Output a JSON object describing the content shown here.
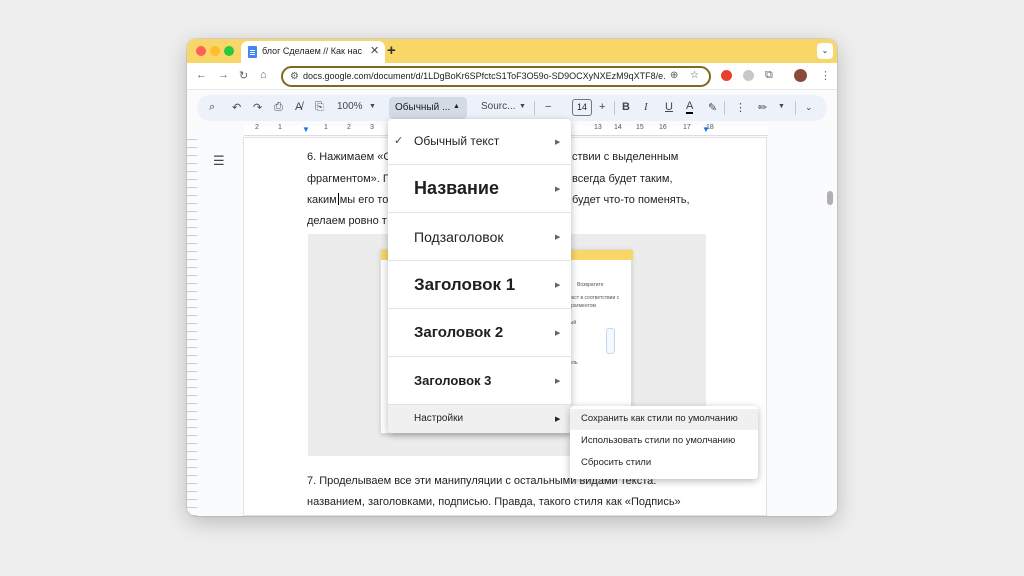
{
  "tab": {
    "title": "блог Сделаем // Как настроить"
  },
  "address": {
    "url": "docs.google.com/document/d/1LDgBoKr6SPfctcS1ToF3O59o-SD9OCXyNXEzM9qXTF8/e..."
  },
  "toolbar": {
    "zoom": "100%",
    "style_value": "Обычный ...",
    "font_value": "Sourc...",
    "font_size": "14"
  },
  "ruler": {
    "numbers": [
      "2",
      "1",
      "1",
      "2",
      "3",
      "4",
      "5",
      "6",
      "7",
      "8",
      "9",
      "10",
      "11",
      "12",
      "13",
      "14",
      "15",
      "16",
      "17",
      "18"
    ]
  },
  "document": {
    "step6_lines": [
      "6. Нажимаем «С",
      "фрагментом». Г",
      "каким",
      "мы его то",
      "делаем ровно т"
    ],
    "step6_right": [
      "ствии с выделенным",
      "всегда будет таким,",
      "будет что-то поменять,"
    ],
    "step7_lines": [
      "7. Проделываем все эти манипуляции с остальными видами текста:",
      "названием, заголовками, подписью. Правда, такого стиля как «Подпись»"
    ]
  },
  "mini_screenshot": {
    "text1": "Обычный текст",
    "text2": "Возвратите",
    "text3": "текст в соответствии с",
    "text4": "фрагментом",
    "text5": "ный",
    "text6": "пуль"
  },
  "style_menu": {
    "items": [
      {
        "label": "Обычный текст",
        "checked": true
      },
      {
        "label": "Название"
      },
      {
        "label": "Подзаголовок"
      },
      {
        "label": "Заголовок 1"
      },
      {
        "label": "Заголовок 2"
      },
      {
        "label": "Заголовок 3"
      },
      {
        "label": "Настройки"
      }
    ]
  },
  "settings_submenu": {
    "items": [
      {
        "label": "Сохранить как стили по умолчанию"
      },
      {
        "label": "Использовать стили по умолчанию"
      },
      {
        "label": "Сбросить стили"
      }
    ]
  },
  "colors": {
    "tabstrip": "#f8d768",
    "toolbar": "#edf2fa",
    "accent": "#4285f4"
  }
}
